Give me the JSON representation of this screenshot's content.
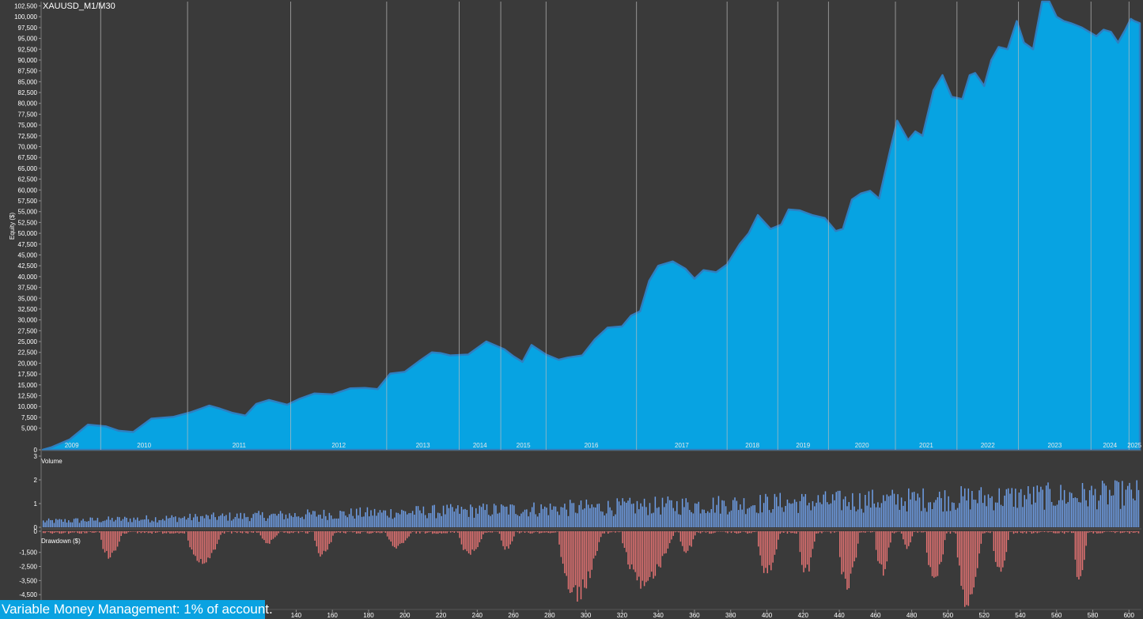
{
  "title": "XAUUSD_M1/M30",
  "banner": "Variable Money Management: 1% of account.",
  "colors": {
    "background": "#3a3a3a",
    "equity_fill": "#07a3e2",
    "equity_edge": "#2f7fc0",
    "volume_bar": "#6f9fe8",
    "drawdown_bar": "#e57373",
    "year_line": "#bdbdbd"
  },
  "chart_data": [
    {
      "type": "area",
      "name": "equity",
      "ylabel": "Equity ($)",
      "ylim": [
        0,
        103500
      ],
      "yticks": [
        0,
        5000,
        7500,
        10000,
        12500,
        15000,
        17500,
        20000,
        22500,
        25000,
        27500,
        30000,
        32500,
        35000,
        37500,
        40000,
        42500,
        45000,
        47500,
        50000,
        52500,
        55000,
        57500,
        60000,
        62500,
        65000,
        67500,
        70000,
        72500,
        75000,
        77500,
        80000,
        82500,
        85000,
        87500,
        90000,
        92500,
        95000,
        97500,
        100000,
        102500
      ],
      "yticklabels": [
        "0",
        "5,000",
        "7,500",
        "10,000",
        "12,500",
        "15,000",
        "17,500",
        "20,000",
        "22,500",
        "25,000",
        "27,500",
        "30,000",
        "32,500",
        "35,000",
        "37,500",
        "40,000",
        "42,500",
        "45,000",
        "47,500",
        "50,000",
        "52,500",
        "55,000",
        "57,500",
        "60,000",
        "62,500",
        "65,000",
        "67,500",
        "70,000",
        "72,500",
        "75,000",
        "77,500",
        "80,000",
        "82,500",
        "85,000",
        "87,500",
        "90,000",
        "92,500",
        "95,000",
        "97,500",
        "100,000",
        "102,500"
      ],
      "x": [
        0,
        5,
        15,
        25,
        35,
        42,
        50,
        60,
        72,
        82,
        92,
        98,
        105,
        112,
        118,
        125,
        135,
        142,
        150,
        160,
        170,
        178,
        185,
        192,
        200,
        208,
        215,
        220,
        225,
        235,
        245,
        255,
        260,
        265,
        270,
        278,
        285,
        290,
        298,
        305,
        312,
        320,
        325,
        330,
        335,
        340,
        348,
        355,
        360,
        365,
        372,
        378,
        385,
        390,
        395,
        402,
        408,
        412,
        418,
        425,
        432,
        438,
        442,
        447,
        452,
        457,
        462,
        468,
        472,
        478,
        482,
        486,
        492,
        497,
        502,
        508,
        512,
        515,
        520,
        524,
        528,
        533,
        538,
        542,
        547,
        552,
        556,
        560,
        564,
        568,
        574,
        578,
        582,
        586,
        590,
        594,
        598,
        601,
        603,
        606
      ],
      "y": [
        0,
        600,
        2400,
        5800,
        5400,
        4400,
        4100,
        7200,
        7600,
        8700,
        10200,
        9500,
        8500,
        7900,
        10600,
        11500,
        10400,
        11800,
        13000,
        12800,
        14200,
        14300,
        14000,
        17600,
        18000,
        20500,
        22500,
        22300,
        21800,
        22000,
        25000,
        23200,
        21600,
        20300,
        24200,
        22000,
        20800,
        21300,
        21800,
        25500,
        28200,
        28500,
        31000,
        32000,
        39000,
        42500,
        43500,
        41800,
        39500,
        41500,
        41000,
        42800,
        47500,
        50000,
        54200,
        51000,
        52000,
        55500,
        55300,
        54200,
        53500,
        50500,
        51000,
        57800,
        59200,
        59800,
        58000,
        69000,
        76000,
        71500,
        73500,
        72500,
        83000,
        86500,
        81500,
        81000,
        86500,
        87000,
        84000,
        90000,
        93000,
        92500,
        99000,
        94000,
        92500,
        106000,
        105000,
        100000,
        99000,
        98500,
        97500,
        96500,
        95500,
        97000,
        96500,
        94000,
        97000,
        99500,
        99000,
        98500
      ],
      "years": [
        "2009",
        "2010",
        "2011",
        "2012",
        "2013",
        "2014",
        "2015",
        "2016",
        "2017",
        "2018",
        "2019",
        "2020",
        "2021",
        "2022",
        "2023",
        "2024",
        "2025"
      ]
    },
    {
      "type": "bar",
      "name": "volume",
      "ylabel": "Volume",
      "ylim": [
        0,
        3
      ],
      "yticks": [
        0,
        1,
        2,
        3
      ],
      "yticklabels": [
        "0",
        "1",
        "2",
        "3"
      ]
    },
    {
      "type": "bar",
      "name": "drawdown",
      "ylabel": "Drawdown ($)",
      "ylim": [
        -5500,
        0
      ],
      "yticks": [
        0,
        -1500,
        -2500,
        -3500,
        -4500
      ],
      "yticklabels": [
        "0",
        "-1,500",
        "-2,500",
        "-3,500",
        "-4,500"
      ],
      "xlim": [
        0,
        606
      ],
      "xticks": [
        140,
        160,
        180,
        200,
        220,
        240,
        260,
        280,
        300,
        320,
        340,
        360,
        380,
        400,
        420,
        440,
        460,
        480,
        500,
        520,
        540,
        560,
        580,
        600
      ],
      "xticklabels": [
        "140",
        "160",
        "180",
        "200",
        "220",
        "240",
        "260",
        "280",
        "300",
        "320",
        "340",
        "360",
        "380",
        "400",
        "420",
        "440",
        "460",
        "480",
        "500",
        "520",
        "540",
        "560",
        "580",
        "600"
      ]
    }
  ]
}
